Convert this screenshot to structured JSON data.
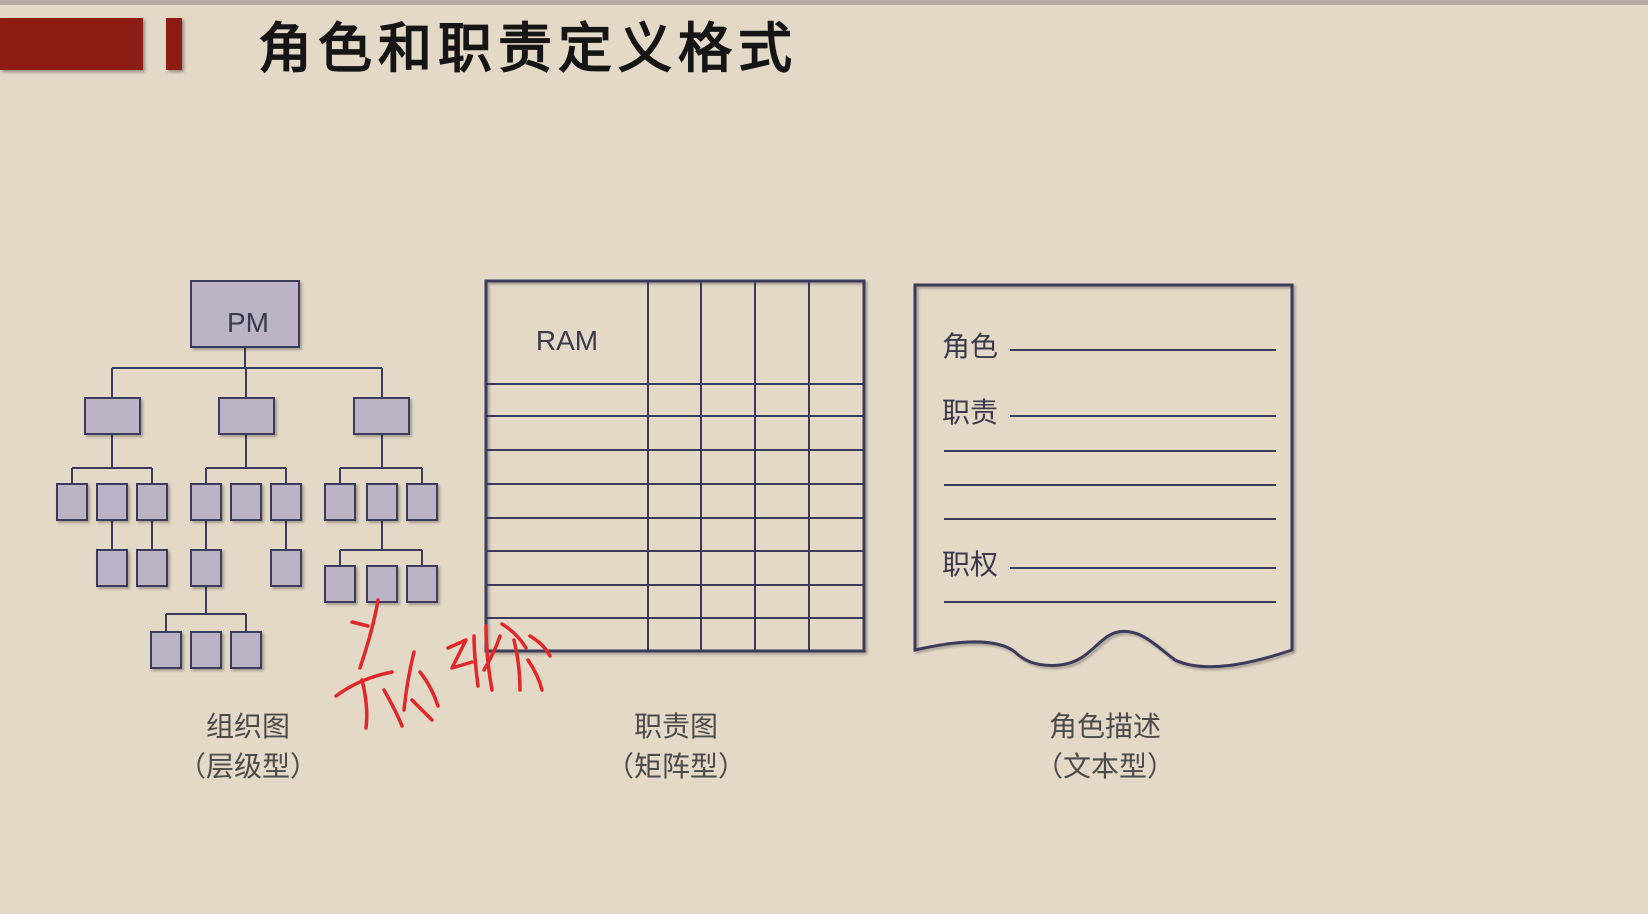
{
  "slide": {
    "title": "角色和职责定义格式"
  },
  "org_chart": {
    "root_label": "PM",
    "caption_line1": "组织图",
    "caption_line2": "（层级型）"
  },
  "ram_matrix": {
    "header_label": "RAM",
    "caption_line1": "职责图",
    "caption_line2": "（矩阵型）"
  },
  "role_doc": {
    "field_role": "角色",
    "field_responsibility": "职责",
    "field_authority": "职权",
    "caption_line1": "角色描述",
    "caption_line2": "（文本型）"
  },
  "colors": {
    "background": "#e4d8c6",
    "title_accent": "#8d1c14",
    "diagram_line": "#3a3a5c",
    "box_fill": "#bcb3c6",
    "handwriting": "#e0282a"
  }
}
